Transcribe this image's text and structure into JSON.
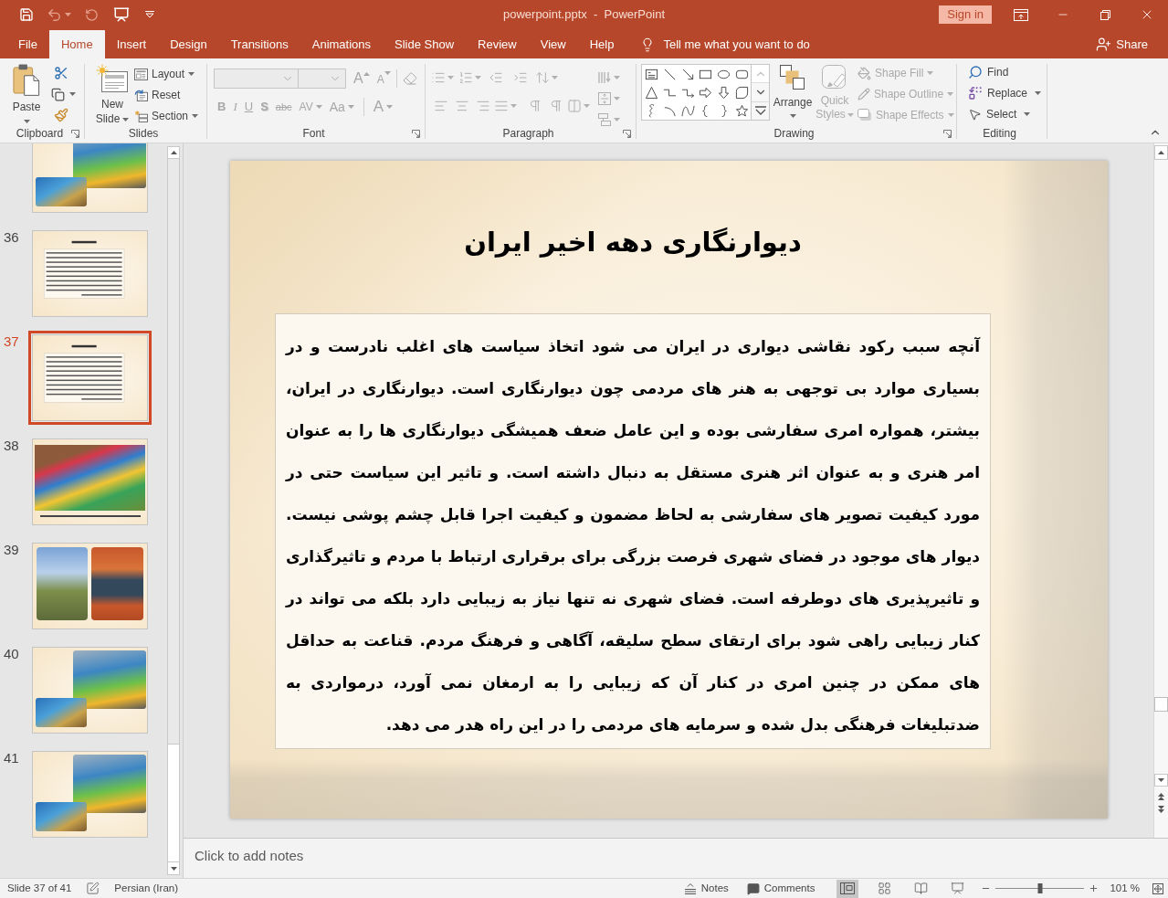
{
  "title_bar": {
    "title": "powerpoint.pptx  -  PowerPoint",
    "sign_in": "Sign in"
  },
  "tabs": [
    {
      "label": "File",
      "selected": false
    },
    {
      "label": "Home",
      "selected": true
    },
    {
      "label": "Insert",
      "selected": false
    },
    {
      "label": "Design",
      "selected": false
    },
    {
      "label": "Transitions",
      "selected": false
    },
    {
      "label": "Animations",
      "selected": false
    },
    {
      "label": "Slide Show",
      "selected": false
    },
    {
      "label": "Review",
      "selected": false
    },
    {
      "label": "View",
      "selected": false
    },
    {
      "label": "Help",
      "selected": false
    }
  ],
  "tell_me": "Tell me what you want to do",
  "share": "Share",
  "ribbon": {
    "clipboard": {
      "label": "Clipboard",
      "paste": "Paste"
    },
    "slides": {
      "label": "Slides",
      "new_slide": "New Slide",
      "items": [
        {
          "label": "Layout",
          "dropdown": true
        },
        {
          "label": "Reset",
          "dropdown": false
        },
        {
          "label": "Section",
          "dropdown": true
        }
      ]
    },
    "font": {
      "label": "Font",
      "disabled": true,
      "size_buttons": [
        {
          "kind": "grow",
          "text": "A"
        },
        {
          "kind": "shrink",
          "text": "A"
        }
      ],
      "buttons": [
        {
          "kind": "bold",
          "text": "B"
        },
        {
          "kind": "italic",
          "text": "I"
        },
        {
          "kind": "underline",
          "text": "U"
        },
        {
          "kind": "shadow",
          "text": "S"
        },
        {
          "kind": "strike",
          "text": "abc"
        },
        {
          "kind": "spacing",
          "text": "AV"
        },
        {
          "kind": "case",
          "text": "Aa"
        },
        {
          "kind": "color",
          "text": "A"
        }
      ]
    },
    "paragraph": {
      "label": "Paragraph",
      "disabled": true
    },
    "drawing": {
      "label": "Drawing",
      "arrange": "Arrange",
      "quick_styles": {
        "label": "Quick Styles",
        "disabled": true
      },
      "shape_options": [
        {
          "label": "Shape Fill",
          "disabled": true
        },
        {
          "label": "Shape Outline",
          "disabled": true
        },
        {
          "label": "Shape Effects",
          "disabled": true
        }
      ]
    },
    "editing": {
      "label": "Editing",
      "items": [
        {
          "kind": "find",
          "label": "Find",
          "dropdown": false
        },
        {
          "kind": "replace",
          "label": "Replace",
          "dropdown": true
        },
        {
          "kind": "select",
          "label": "Select",
          "dropdown": true
        }
      ]
    }
  },
  "thumbnails": [
    {
      "kind": "overlap-photos",
      "selected": false
    },
    {
      "number": "36",
      "kind": "text",
      "selected": false
    },
    {
      "number": "37",
      "kind": "text",
      "selected": true
    },
    {
      "number": "38",
      "kind": "wide-photo",
      "selected": false
    },
    {
      "number": "39",
      "kind": "two-photos",
      "selected": false
    },
    {
      "number": "40",
      "kind": "overlap-photos",
      "selected": false
    },
    {
      "number": "41",
      "kind": "overlap-photos",
      "selected": false
    }
  ],
  "slide": {
    "title": "دیوارنگاری دهه اخیر ایران",
    "body": "آنچه سبب رکود نقاشی دیواری در ایران می شود اتخاذ سیاست های اغلب نادرست و در بسیاری موارد بی توجهی به هنر های مردمی چون دیوارنگاری است. دیوارنگاری در ایران، بیشتر، همواره امری سفارشی بوده و این عامل ضعف همیشگی دیوارنگاری ها را به عنوان امر هنری و به عنوان اثر هنری مستقل به دنبال داشته است. و تاثیر این سیاست حتی در مورد کیفیت تصویر های سفارشی به لحاظ مضمون و کیفیت اجرا قابل چشم پوشی نیست. دیوار های موجود در فضای شهری فرصت بزرگی برای برقراری ارتباط با مردم و تاثیرگذاری و تاثیرپذیری های دوطرفه است. فضای شهری نه تنها نیاز به زیبایی دارد بلکه می تواند در کنار زیبایی راهی شود برای ارتقای سطح سلیقه، آگاهی و فرهنگ مردم. قناعت به حداقل های ممکن در چنین امری در کنار آن که زیبایی را به ارمغان نمی آورد، درمواردی به ضدتبلیغات فرهنگی بدل شده و سرمایه های مردمی را در این راه هدر می دهد."
  },
  "notes": {
    "placeholder": "Click to add notes"
  },
  "status_bar": {
    "slide_indicator": "Slide 37 of 41",
    "language": "Persian (Iran)",
    "notes": "Notes",
    "comments": "Comments",
    "views": [
      {
        "kind": "normal",
        "selected": true
      },
      {
        "kind": "sorter",
        "selected": false
      },
      {
        "kind": "reading",
        "selected": false
      },
      {
        "kind": "slideshow",
        "selected": false
      }
    ],
    "zoom": {
      "level": 0.5,
      "reading": "101 %"
    }
  }
}
